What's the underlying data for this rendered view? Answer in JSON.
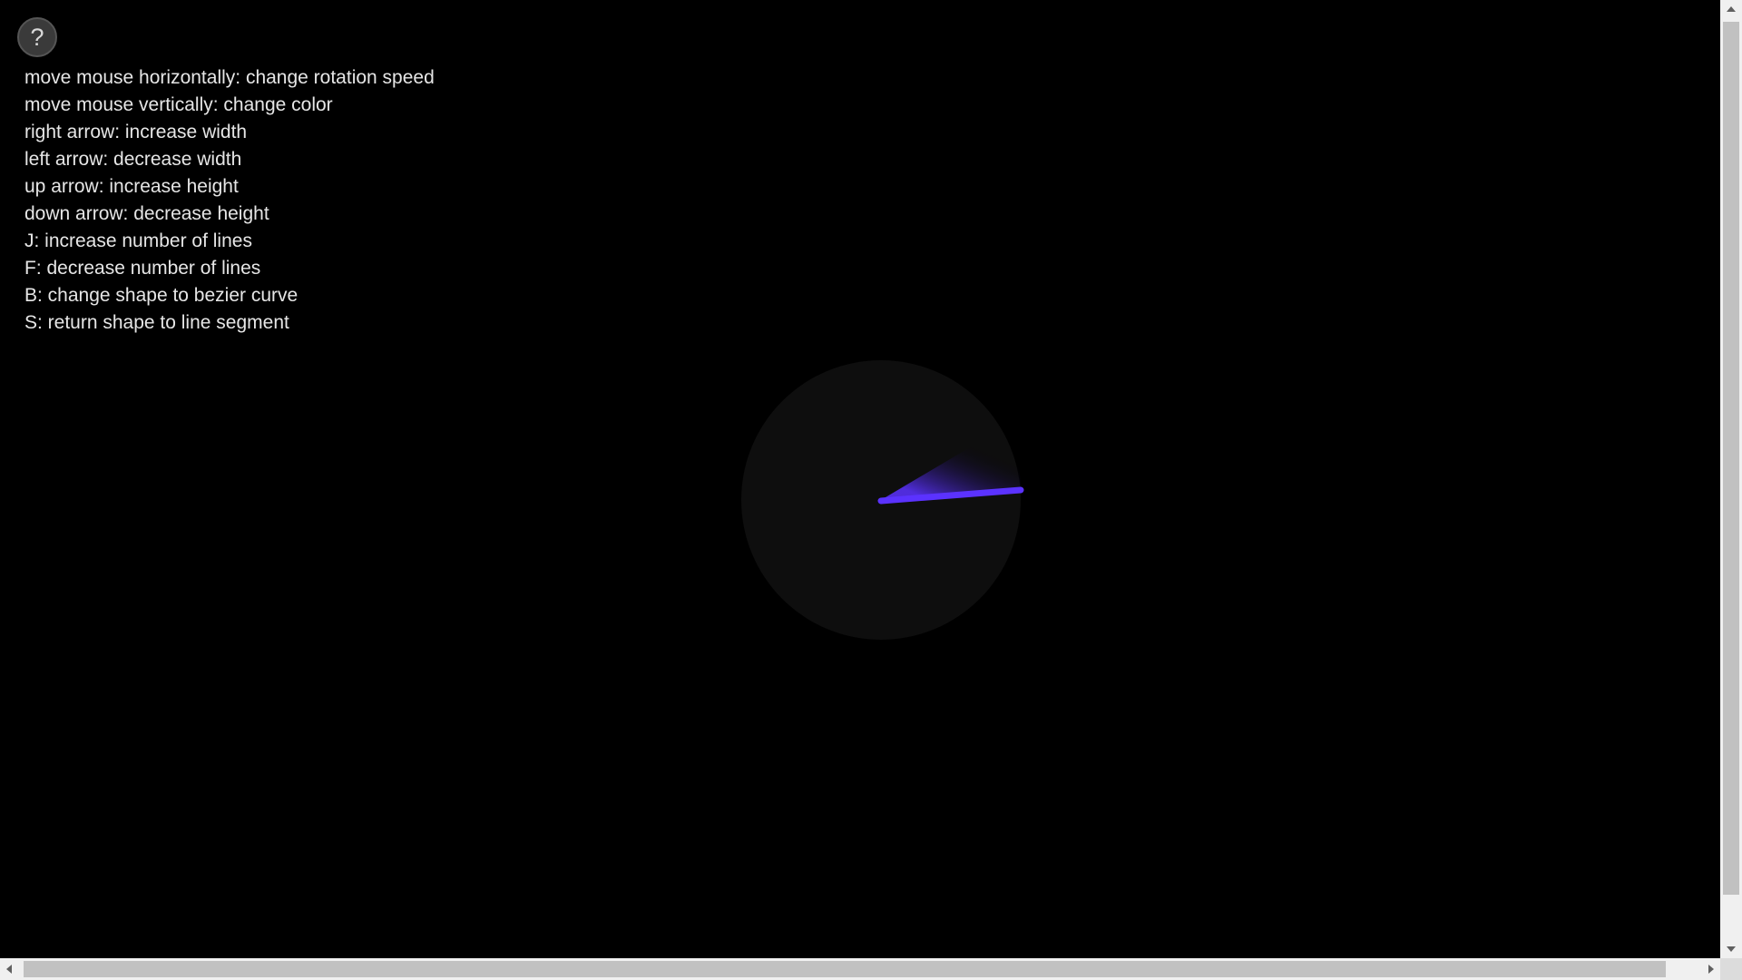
{
  "help_button": {
    "label": "?",
    "icon": "help-icon"
  },
  "instructions": [
    "move mouse horizontally: change rotation speed",
    "move mouse vertically: change color",
    "right arrow: increase width",
    "left arrow: decrease width",
    "up arrow: increase height",
    "down arrow: decrease height",
    "J: increase number of lines",
    "F: decrease number of lines",
    "B: change shape to bezier curve",
    "S: return shape to line segment"
  ],
  "visual": {
    "background_color": "#000000",
    "disc_color": "#0e0e0e",
    "line_color": "#5b32ff",
    "shape": "line segment"
  }
}
